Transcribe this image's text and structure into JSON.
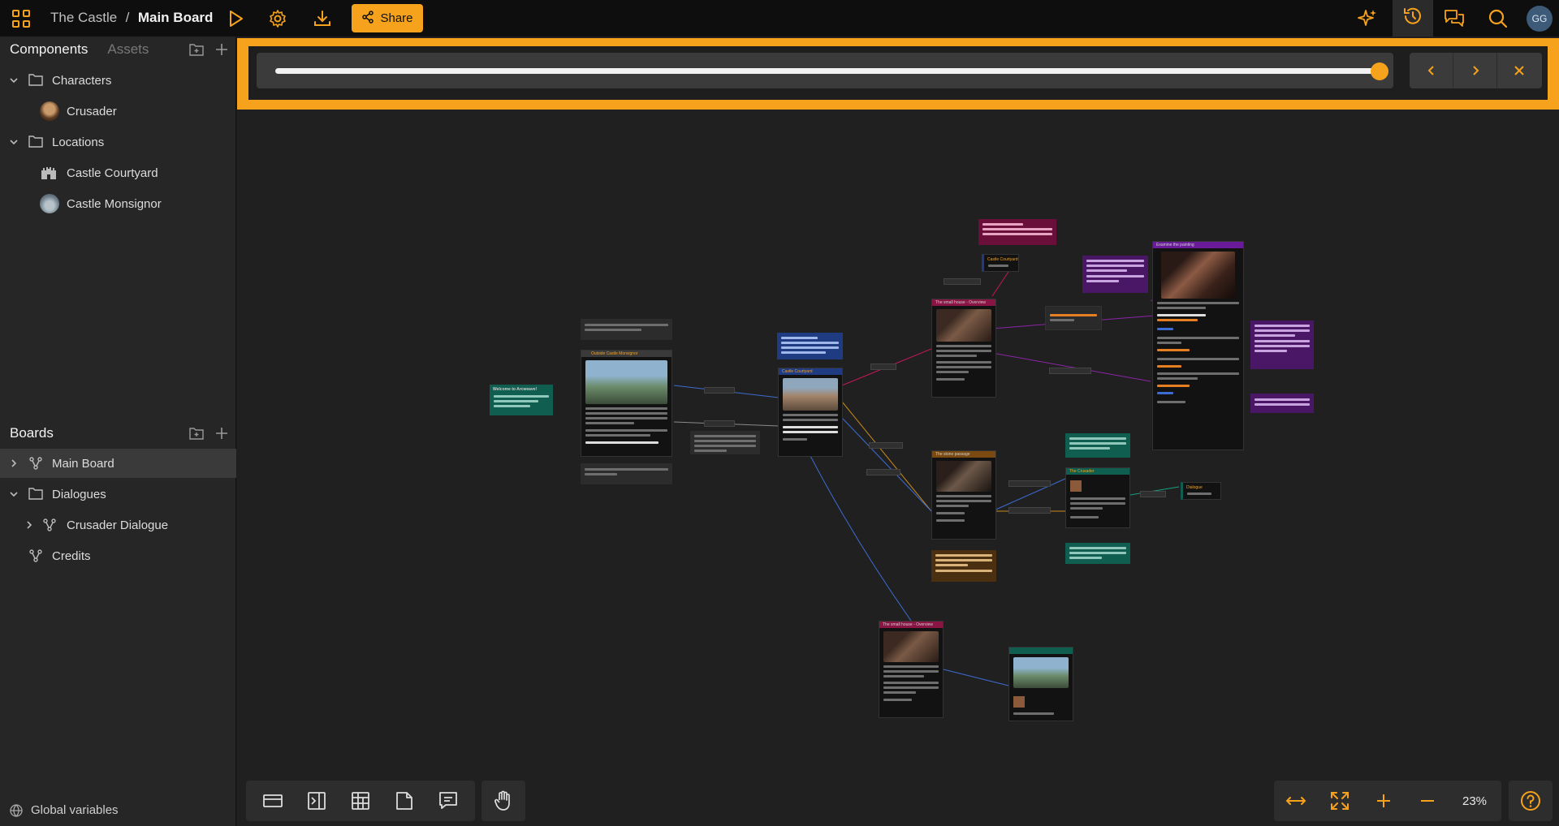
{
  "header": {
    "project": "The Castle",
    "separator": "/",
    "board": "Main Board",
    "share_label": "Share",
    "user_initials": "GG",
    "accent": "#f7a21c"
  },
  "icons": {
    "apps": "grid-icon",
    "play": "play-icon",
    "settings": "gear-icon",
    "export": "download-icon",
    "share": "share-icon",
    "ai": "sparkle-icon",
    "history": "history-icon",
    "comments": "comments-icon",
    "search": "search-icon"
  },
  "sidebar": {
    "tabs": [
      "Components",
      "Assets"
    ],
    "components": {
      "characters_folder": "Characters",
      "characters": [
        "Crusader"
      ],
      "locations_folder": "Locations",
      "locations": [
        "Castle Courtyard",
        "Castle Monsignor"
      ]
    },
    "boards_title": "Boards",
    "boards": {
      "main": "Main Board",
      "dialogues_folder": "Dialogues",
      "crusader_dialogue": "Crusader Dialogue",
      "credits": "Credits"
    },
    "global_variables": "Global variables"
  },
  "replay": {
    "progress": 1.0
  },
  "canvas": {
    "zoom": "23%",
    "nodes": {
      "outside": "Outside Castle Monsignor",
      "courtyard": "Castle Courtyard",
      "small_house": "The small house - Overview",
      "stone_passage": "The stone passage",
      "crusader": "The Crusader",
      "painting": "Examine the painting",
      "castle_courtyard_jump": "Castle Courtyard",
      "dialogue": "Dialogue",
      "small_house_2": "The small house - Overview",
      "welcome": "Welcome to Arcweave!"
    }
  }
}
